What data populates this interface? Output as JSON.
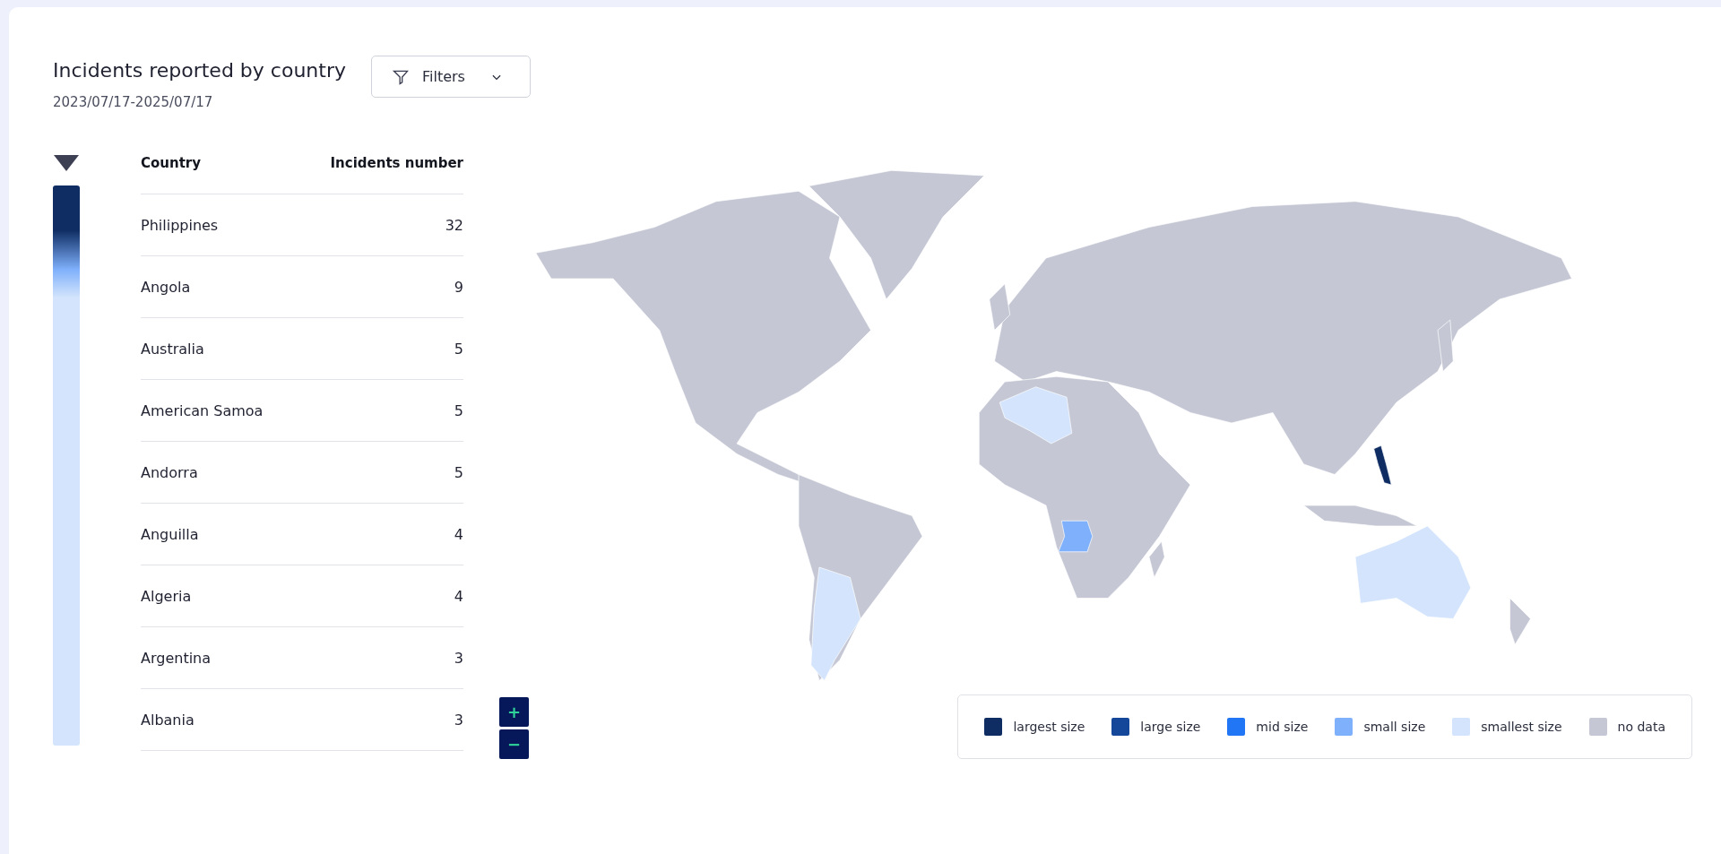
{
  "header": {
    "title": "Incidents reported by country",
    "date_range": "2023/07/17-2025/07/17",
    "filters_button": "Filters"
  },
  "table": {
    "columns": [
      "Country",
      "Incidents number"
    ],
    "rows": [
      {
        "country": "Philippines",
        "incidents": "32"
      },
      {
        "country": "Angola",
        "incidents": "9"
      },
      {
        "country": "Australia",
        "incidents": "5"
      },
      {
        "country": "American Samoa",
        "incidents": "5"
      },
      {
        "country": "Andorra",
        "incidents": "5"
      },
      {
        "country": "Anguilla",
        "incidents": "4"
      },
      {
        "country": "Algeria",
        "incidents": "4"
      },
      {
        "country": "Argentina",
        "incidents": "3"
      },
      {
        "country": "Albania",
        "incidents": "3"
      }
    ]
  },
  "zoom_controls": [
    "+",
    "−"
  ],
  "legend": [
    {
      "label": "largest size",
      "color": "#0f2d63"
    },
    {
      "label": "large size",
      "color": "#14479a"
    },
    {
      "label": "mid size",
      "color": "#2176f5"
    },
    {
      "label": "small size",
      "color": "#7fb0fb"
    },
    {
      "label": "smallest size",
      "color": "#d3e4fc"
    },
    {
      "label": "no data",
      "color": "#c5c8d4"
    }
  ]
}
